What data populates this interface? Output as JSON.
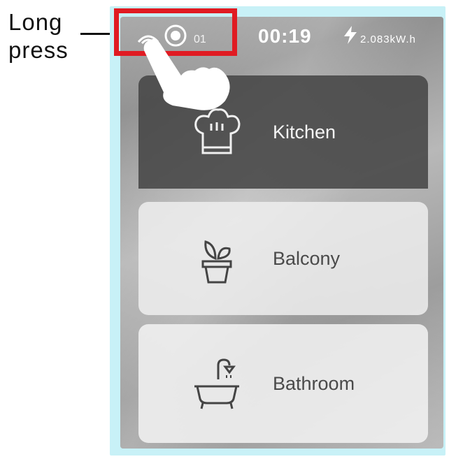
{
  "annotation": {
    "line1": "Long",
    "line2": "press"
  },
  "status_bar": {
    "wifi_icon": "wifi-icon",
    "device_icon": "ring-icon",
    "device_number": "01",
    "time": "00:19",
    "energy_icon": "lightning-icon",
    "energy": "2.083kW.h"
  },
  "rooms": [
    {
      "label": "Kitchen",
      "icon": "chef-hat-icon"
    },
    {
      "label": "Balcony",
      "icon": "potted-plant-icon"
    },
    {
      "label": "Bathroom",
      "icon": "bathtub-icon"
    }
  ],
  "colors": {
    "highlight": "#e01b22",
    "frame": "#c8f1f7",
    "kitchen_tile": "#464646",
    "light_tile": "#eeeeee"
  }
}
